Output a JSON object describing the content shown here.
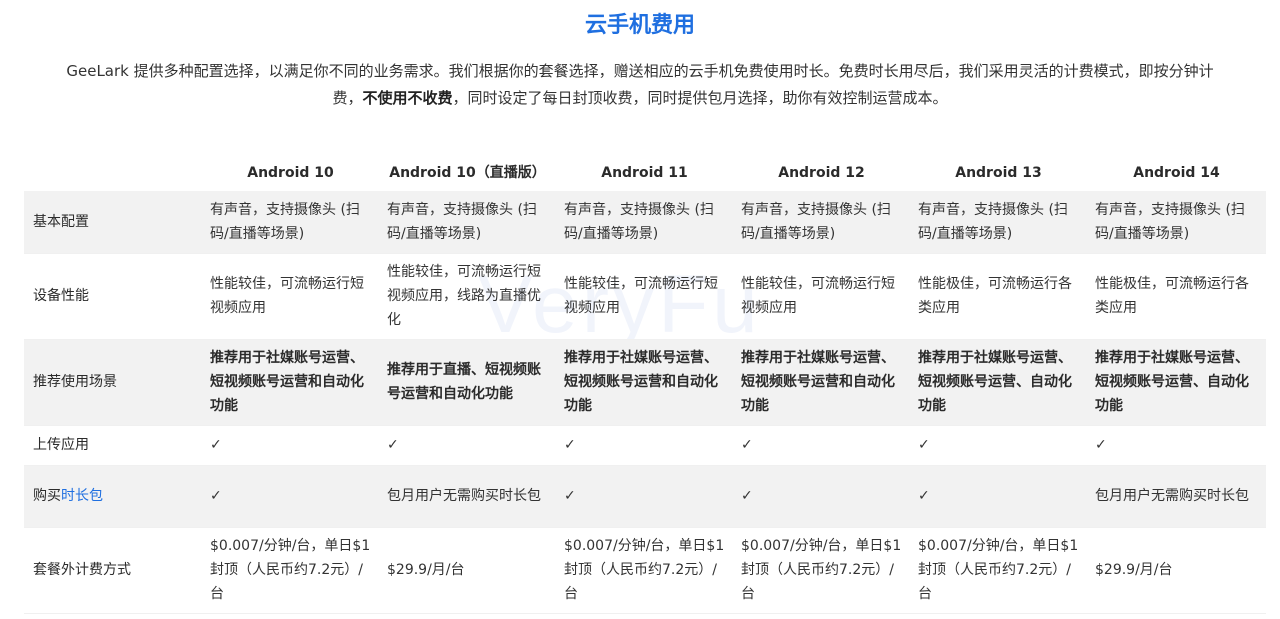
{
  "page": {
    "title": "云手机费用",
    "intro_part1": "GeeLark 提供多种配置选择，以满足你不同的业务需求。我们根据你的套餐选择，赠送相应的云手机免费使用时长。免费时长用尽后，我们采用灵活的计费模式，即按分钟计费，",
    "intro_bold": "不使用不收费",
    "intro_part2": "，同时设定了每日封顶收费，同时提供包月选择，助你有效控制运营成本。",
    "watermark": "VeryFu"
  },
  "table": {
    "headers": [
      "",
      "Android 10",
      "Android 10（直播版）",
      "Android 11",
      "Android 12",
      "Android 13",
      "Android 14"
    ],
    "rows": [
      {
        "label": "基本配置",
        "cells": [
          "有声音，支持摄像头 (扫码/直播等场景)",
          "有声音，支持摄像头 (扫码/直播等场景)",
          "有声音，支持摄像头 (扫码/直播等场景)",
          "有声音，支持摄像头 (扫码/直播等场景)",
          "有声音，支持摄像头 (扫码/直播等场景)",
          "有声音，支持摄像头 (扫码/直播等场景)"
        ]
      },
      {
        "label": "设备性能",
        "cells": [
          "性能较佳，可流畅运行短视频应用",
          "性能较佳，可流畅运行短视频应用，线路为直播优化",
          "性能较佳，可流畅运行短视频应用",
          "性能较佳，可流畅运行短视频应用",
          "性能极佳，可流畅运行各类应用",
          "性能极佳，可流畅运行各类应用"
        ]
      },
      {
        "label": "推荐使用场景",
        "cells": [
          "推荐用于社媒账号运营、短视频账号运营和自动化功能",
          "推荐用于直播、短视频账号运营和自动化功能",
          "推荐用于社媒账号运营、短视频账号运营和自动化功能",
          "推荐用于社媒账号运营、短视频账号运营和自动化功能",
          "推荐用于社媒账号运营、短视频账号运营、自动化功能",
          "推荐用于社媒账号运营、短视频账号运营、自动化功能"
        ]
      },
      {
        "label": "上传应用",
        "cells": [
          "✓",
          "✓",
          "✓",
          "✓",
          "✓",
          "✓"
        ]
      },
      {
        "label_prefix": "购买",
        "label_link": "时长包",
        "cells": [
          "✓",
          "包月用户无需购买时长包",
          "✓",
          "✓",
          "✓",
          "包月用户无需购买时长包"
        ]
      },
      {
        "label": "套餐外计费方式",
        "cells": [
          "$0.007/分钟/台，单日$1封顶（人民币约7.2元）/台",
          "$29.9/月/台",
          "$0.007/分钟/台，单日$1封顶（人民币约7.2元）/台",
          "$0.007/分钟/台，单日$1封顶（人民币约7.2元）/台",
          "$0.007/分钟/台，单日$1封顶（人民币约7.2元）/台",
          "$29.9/月/台"
        ]
      }
    ]
  },
  "colors": {
    "accent": "#1f6fe0",
    "row_shade": "#f2f2f2"
  }
}
